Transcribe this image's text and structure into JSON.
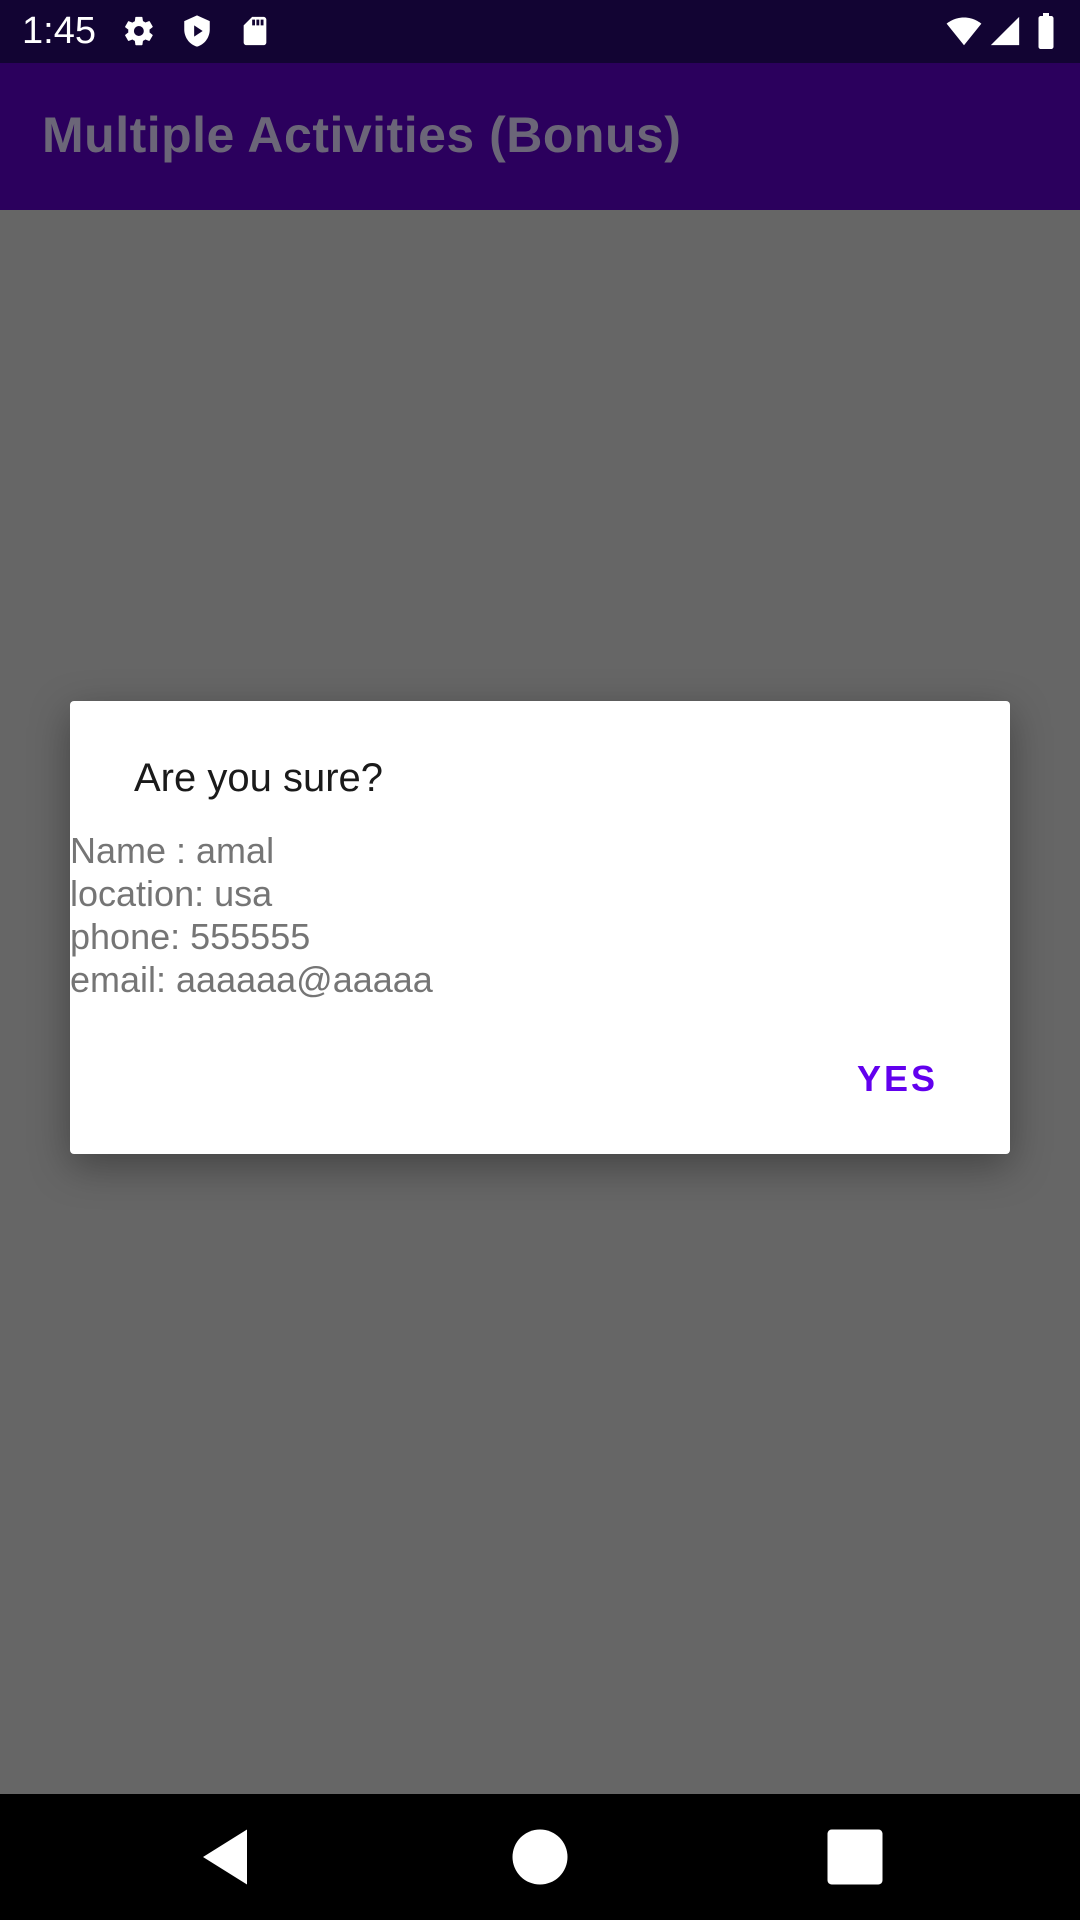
{
  "status_bar": {
    "time": "1:45",
    "icons": [
      "gear-icon",
      "play-protect-icon",
      "sd-card-icon",
      "wifi-icon",
      "cell-signal-icon",
      "battery-icon"
    ]
  },
  "app_bar": {
    "title": "Multiple Activities (Bonus)"
  },
  "dialog": {
    "title": "Are you sure?",
    "lines": [
      "Name : amal",
      "location: usa",
      "phone: 555555",
      "email: aaaaaa@aaaaa"
    ],
    "confirm_label": "YES"
  },
  "nav_bar": {
    "buttons": [
      "back-icon",
      "home-icon",
      "recents-icon"
    ]
  },
  "colors": {
    "status_bar": "#120433",
    "app_bar": "#2b005d",
    "scrim": "#666666",
    "accent": "#6200ee"
  }
}
